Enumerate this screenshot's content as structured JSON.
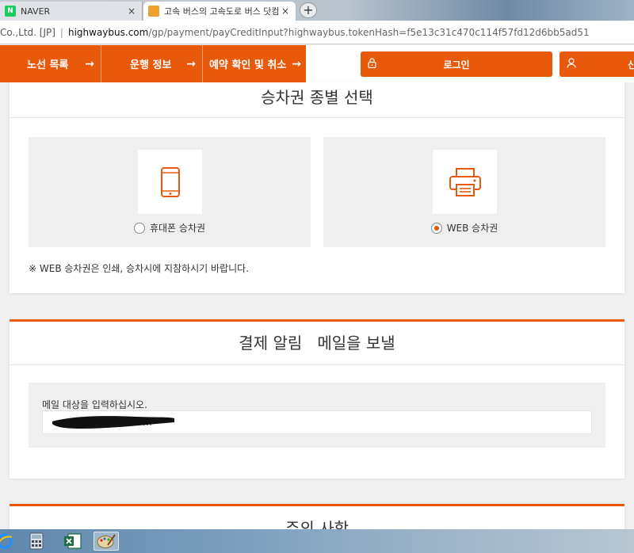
{
  "browser": {
    "tabs": [
      {
        "title": "NAVER",
        "icon": "naver-icon"
      },
      {
        "title": "고속 버스의 고속도로 버스 닷컴",
        "icon": "bus-favicon"
      }
    ],
    "new_tab_symbol": "+",
    "close_symbol": "×",
    "address": {
      "certificate": "Co.,Ltd. [JP]",
      "separator": "|",
      "host": "highwaybus.com",
      "path": "/gp/payment/payCreditInput?highwaybus.tokenHash=f5e13c31c470c114f57fd12d6bb5ad51"
    }
  },
  "nav": {
    "items": [
      {
        "label": "노선 목록",
        "arrow": "→"
      },
      {
        "label": "운행 정보",
        "arrow": "→"
      },
      {
        "label": "예약 확인 및 취소",
        "arrow": "→"
      }
    ],
    "login_label": "로그인",
    "signup_label": "신",
    "accent_color": "#e8590c"
  },
  "ticket_type": {
    "title": "승차권 종별 선택",
    "options": [
      {
        "label": "휴대폰 승차권",
        "icon": "smartphone-icon",
        "selected": false
      },
      {
        "label": "WEB 승차권",
        "icon": "printer-icon",
        "selected": true
      }
    ],
    "note": "※ WEB 승차권은 인쇄, 승차시에 지참하시기 바랍니다."
  },
  "payment_mail": {
    "title": "결제 알림   메일을 보낼",
    "field_label": "메일 대상을 입력하십시오.",
    "field_value": "m"
  },
  "notice": {
    "title": "주의 사항"
  },
  "taskbar": {
    "icons": [
      "ie-icon",
      "calculator-icon",
      "excel-icon",
      "paint-icon"
    ]
  }
}
